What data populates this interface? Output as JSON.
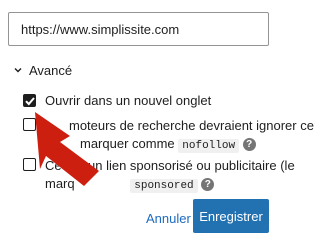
{
  "link": {
    "url_value": "https://www.simplissite.com"
  },
  "advanced": {
    "label": "Avancé",
    "options": [
      {
        "checked": true,
        "line1": "Ouvrir dans un nouvel onglet"
      },
      {
        "checked": false,
        "line1": "moteurs de recherche devraient ignorer ce",
        "line2_text": "marquer comme",
        "code": "nofollow"
      },
      {
        "checked": false,
        "line1_prefix": "Ce",
        "line1": "un lien sponsorisé ou publicitaire (le",
        "line2_text": "marq",
        "code": "sponsored"
      }
    ]
  },
  "actions": {
    "cancel_label": "Annuler",
    "save_label": "Enregistrer"
  },
  "annotation": {
    "arrow_color": "#cc1f10"
  },
  "colors": {
    "primary": "#2271b1",
    "link": "#1e6ac2"
  }
}
